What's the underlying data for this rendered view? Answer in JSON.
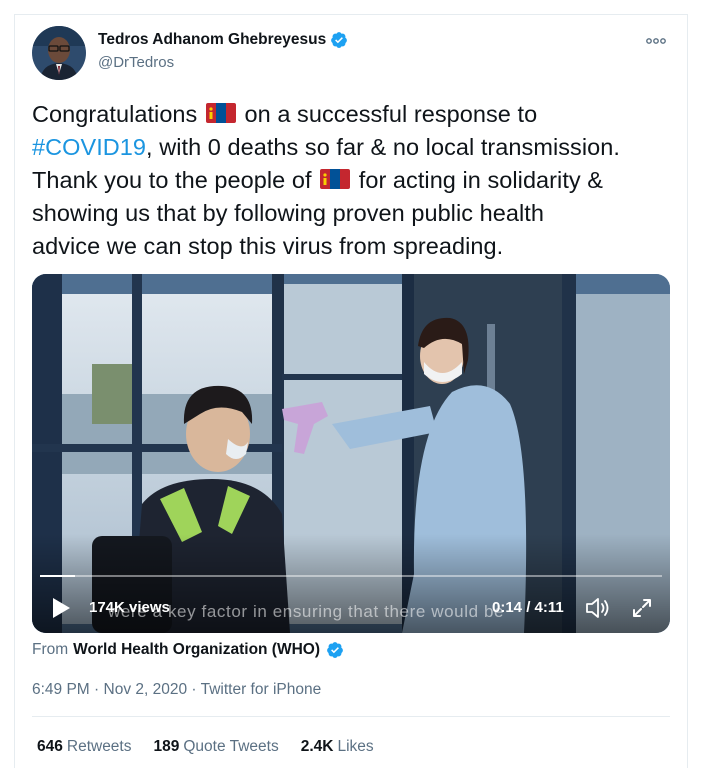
{
  "author": {
    "name": "Tedros Adhanom Ghebreyesus",
    "handle": "@DrTedros",
    "verified_color": "#1da1f2"
  },
  "more_icon": "more-horizontal-icon",
  "tweet": {
    "line1_a": "Congratulations",
    "line1_b": " on a successful response to",
    "line2_hashtag": "#COVID19",
    "line2_rest": ", with 0 deaths so far & no local transmission.",
    "line3_a": "Thank you to the people of",
    "line3_b": " for acting in solidarity &",
    "line4": "showing us that by following proven public health",
    "line5": "advice we can stop this virus from spreading.",
    "flag_icon": "mongolia-flag-icon",
    "hashtag_color": "#1b95e0"
  },
  "video": {
    "subtitle": "were a key factor in ensuring that there would be",
    "views": "174K views",
    "current_time": "0:14",
    "separator": " / ",
    "duration": "4:11",
    "progress": 0.056,
    "play_icon": "play-icon",
    "volume_icon": "volume-icon",
    "expand_icon": "fullscreen-icon"
  },
  "source": {
    "prefix": "From",
    "org": "World Health Organization (WHO)"
  },
  "meta": {
    "time": "6:49 PM",
    "dot1": " · ",
    "date": "Nov 2, 2020",
    "dot2": " · ",
    "client": "Twitter for iPhone"
  },
  "stats": {
    "retweets_count": "646",
    "retweets_label": "Retweets",
    "quotes_count": "189",
    "quotes_label": "Quote Tweets",
    "likes_count": "2.4K",
    "likes_label": "Likes"
  }
}
